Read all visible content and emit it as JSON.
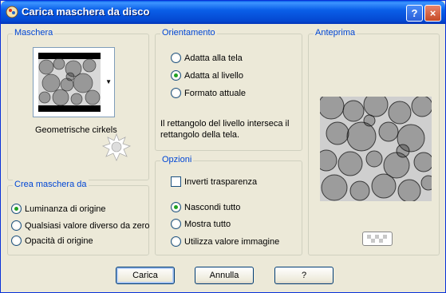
{
  "window": {
    "title": "Carica maschera da disco",
    "help_glyph": "?",
    "close_glyph": "×"
  },
  "maschera": {
    "label": "Maschera",
    "selected_mask": "Geometrische cirkels"
  },
  "crea": {
    "label": "Crea maschera da",
    "options": [
      {
        "label": "Luminanza di origine",
        "checked": true
      },
      {
        "label": "Qualsiasi valore diverso da zero",
        "checked": false
      },
      {
        "label": "Opacità di origine",
        "checked": false
      }
    ]
  },
  "orientamento": {
    "label": "Orientamento",
    "options": [
      {
        "label": "Adatta alla tela",
        "checked": false
      },
      {
        "label": "Adatta al livello",
        "checked": true
      },
      {
        "label": "Formato attuale",
        "checked": false
      }
    ],
    "note": "Il rettangolo del livello interseca il rettangolo della tela."
  },
  "opzioni": {
    "label": "Opzioni",
    "invert_label": "Inverti trasparenza",
    "invert_checked": false,
    "options": [
      {
        "label": "Nascondi tutto",
        "checked": true
      },
      {
        "label": "Mostra tutto",
        "checked": false
      },
      {
        "label": "Utilizza valore immagine",
        "checked": false
      }
    ]
  },
  "anteprima": {
    "label": "Anteprima"
  },
  "buttons": {
    "load": "Carica",
    "cancel": "Annulla",
    "help": "?"
  }
}
